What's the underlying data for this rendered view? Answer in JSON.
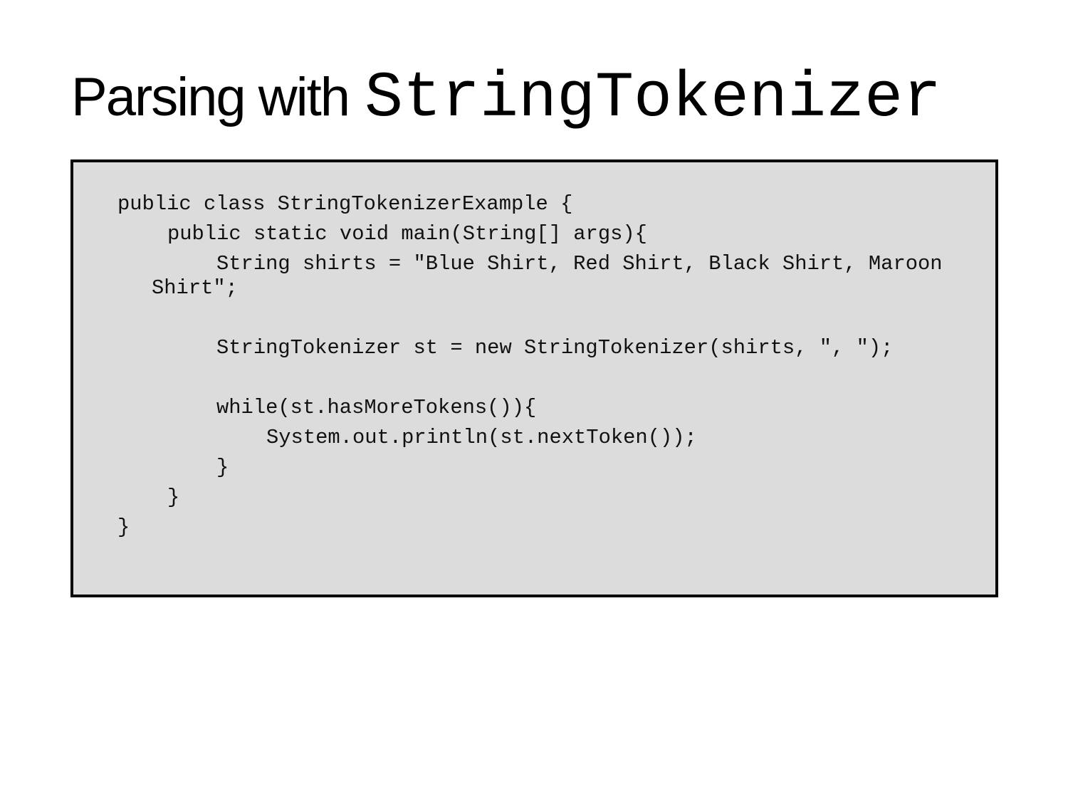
{
  "title": {
    "prefix": "Parsing with",
    "code": "StringTokenizer"
  },
  "code_lines": [
    "public class StringTokenizerExample {",
    "public static void main(String[] args){",
    "String shirts = \"Blue Shirt, Red Shirt, Black Shirt, Maroon",
    "Shirt\";",
    "StringTokenizer st = new StringTokenizer(shirts, \", \");",
    "while(st.hasMoreTokens()){",
    "System.out.println(st.nextToken());",
    "}",
    "}",
    "}"
  ]
}
